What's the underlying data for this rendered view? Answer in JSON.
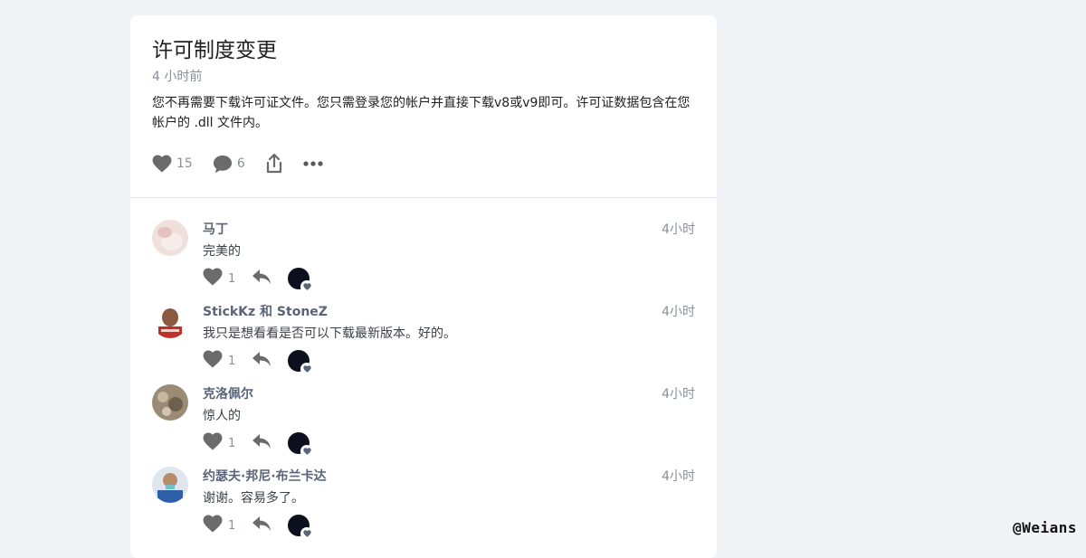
{
  "post": {
    "title": "许可制度变更",
    "time": "4 小时前",
    "body": "您不再需要下载许可证文件。您只需登录您的帐户并直接下载v8或v9即可。许可证数据包含在您帐户的 .dll 文件内。",
    "likes": "15",
    "comments": "6"
  },
  "comments": [
    {
      "author": "马丁",
      "time": "4小时",
      "text": "完美的",
      "likes": "1",
      "avatar_color": "#e9d3cf"
    },
    {
      "author": "StickKz 和 StoneZ",
      "time": "4小时",
      "text": "我只是想看看是否可以下载最新版本。好的。",
      "likes": "1",
      "avatar_color": "#b8302c"
    },
    {
      "author": "克洛佩尔",
      "time": "4小时",
      "text": "惊人的",
      "likes": "1",
      "avatar_color": "#8a7b66"
    },
    {
      "author": "约瑟夫·邦尼·布兰卡达",
      "time": "4小时",
      "text": "谢谢。容易多了。",
      "likes": "1",
      "avatar_color": "#2f5fa8"
    }
  ],
  "watermark": "@Weians",
  "colors": {
    "icon": "#6b6b6b",
    "author": "#5b6478",
    "muted": "#8a8f98"
  }
}
